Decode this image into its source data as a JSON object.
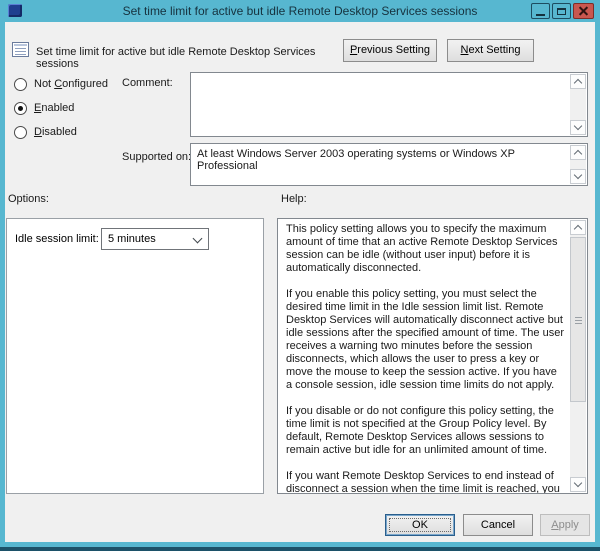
{
  "theme": {
    "chrome_blue": "#57b7d0",
    "chrome_dark_edge": "#1c5168",
    "close_red": "#c9574f",
    "client_gray": "#f0f0f0",
    "default_button_border": "#2a5e8c"
  },
  "titlebar": {
    "title": "Set time limit for active but idle Remote Desktop Services sessions",
    "minimize_icon": "minimize-dash",
    "maximize_icon": "maximize-square",
    "close_icon": "close-x"
  },
  "header": {
    "setting_title": "Set time limit for active but idle Remote Desktop Services sessions",
    "previous_button": {
      "pre": "",
      "u": "P",
      "post": "revious Setting"
    },
    "next_button": {
      "pre": "",
      "u": "N",
      "post": "ext Setting"
    }
  },
  "config": {
    "radio_options": [
      {
        "pre": "Not ",
        "u": "C",
        "post": "onfigured",
        "checked": false
      },
      {
        "pre": "",
        "u": "E",
        "post": "nabled",
        "checked": true
      },
      {
        "pre": "",
        "u": "D",
        "post": "isabled",
        "checked": false
      }
    ],
    "comment_label": "Comment:",
    "comment_value": "",
    "supported_label": "Supported on:",
    "supported_value": "At least Windows Server 2003 operating systems or Windows XP Professional"
  },
  "options": {
    "section_label": "Options:",
    "idle_limit_label": "Idle session limit:",
    "idle_limit_value": "5 minutes"
  },
  "help": {
    "section_label": "Help:",
    "paragraphs": [
      "This policy setting allows you to specify the maximum amount of time that an active Remote Desktop Services session can be idle (without user input) before it is automatically disconnected.",
      "If you enable this policy setting, you must select the desired time limit in the Idle session limit list. Remote Desktop Services will automatically disconnect active but idle sessions after the specified amount of time. The user receives a warning two minutes before the session disconnects, which allows the user to press a key or move the mouse to keep the session active. If you have a console session, idle session time limits do not apply.",
      "If you disable or do not configure this policy setting, the time limit is not specified at the Group Policy level. By default, Remote Desktop Services allows sessions to remain active but idle for an unlimited amount of time.",
      "If you want Remote Desktop Services to end instead of disconnect a session when the time limit is reached, you can configure the policy setting Computer Configuration \\Administrative Templates\\Windows Components\\Remote"
    ]
  },
  "footer": {
    "ok_label": "OK",
    "cancel_label": "Cancel",
    "apply_label": {
      "pre": "",
      "u": "A",
      "post": "pply"
    }
  }
}
